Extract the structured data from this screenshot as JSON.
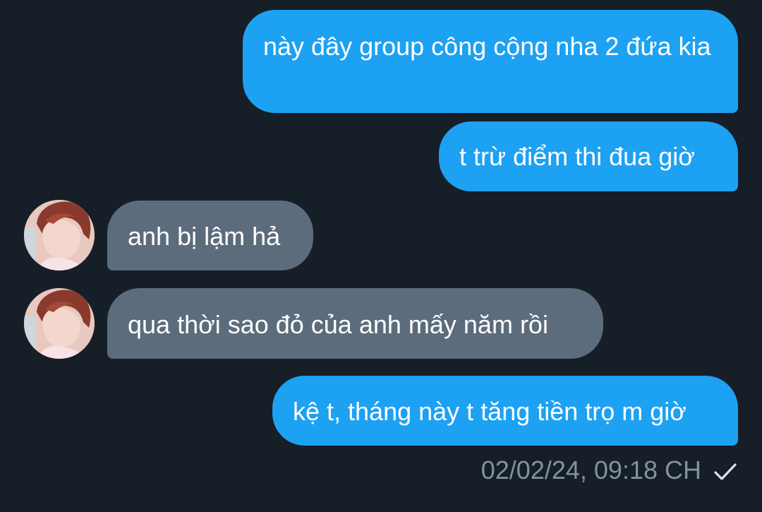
{
  "messages": [
    {
      "direction": "outgoing",
      "text": "này đây group công cộng nha 2 đứa kia"
    },
    {
      "direction": "outgoing",
      "text": "t trừ điểm thi đua giờ"
    },
    {
      "direction": "incoming",
      "text": "anh bị lậm hả"
    },
    {
      "direction": "incoming",
      "text": "qua thời sao đỏ của anh mấy năm rồi"
    },
    {
      "direction": "outgoing",
      "text": "kệ t, tháng này t tăng tiền trọ m giờ"
    }
  ],
  "last_message_meta": {
    "timestamp": "02/02/24, 09:18 CH",
    "status_icon": "check-icon"
  },
  "colors": {
    "background": "#161e28",
    "outgoing_bubble": "#1da1f2",
    "incoming_bubble": "#5c6c7c",
    "meta_text": "#8391a0"
  }
}
